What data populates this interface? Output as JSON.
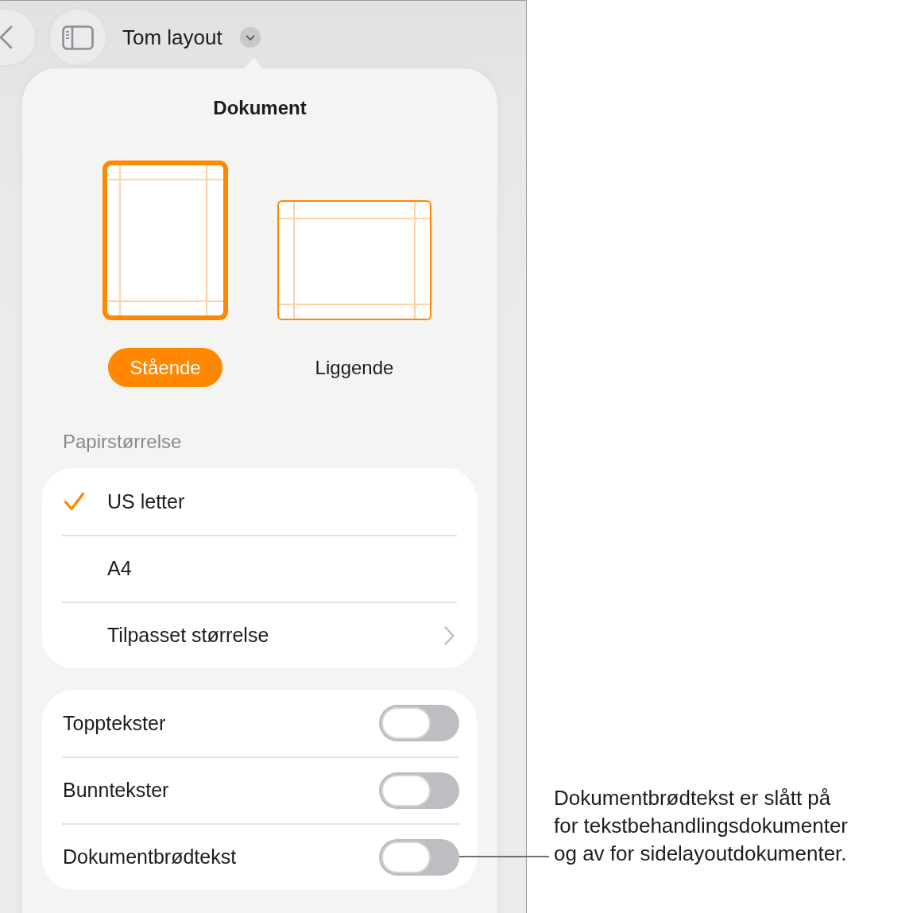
{
  "toolbar": {
    "title": "Tom layout"
  },
  "popover": {
    "title": "Dokument"
  },
  "orientations": [
    {
      "kind": "portrait",
      "label": "Stående",
      "selected": true
    },
    {
      "kind": "landscape",
      "label": "Liggende",
      "selected": false
    }
  ],
  "paper_size": {
    "heading": "Papirstørrelse",
    "options": [
      {
        "kind": "option",
        "label": "US letter",
        "selected": true
      },
      {
        "kind": "option",
        "label": "A4",
        "selected": false
      },
      {
        "kind": "submenu",
        "label": "Tilpasset størrelse",
        "selected": false
      }
    ]
  },
  "settings": [
    {
      "label": "Topptekster",
      "on": false
    },
    {
      "label": "Bunntekster",
      "on": false
    },
    {
      "label": "Dokumentbrødtekst",
      "on": false
    }
  ],
  "callout": {
    "lines": [
      "Dokumentbrødtekst er slått på",
      "for tekstbehandlingsdokumenter",
      "og av for sidelayoutdokumenter."
    ]
  }
}
